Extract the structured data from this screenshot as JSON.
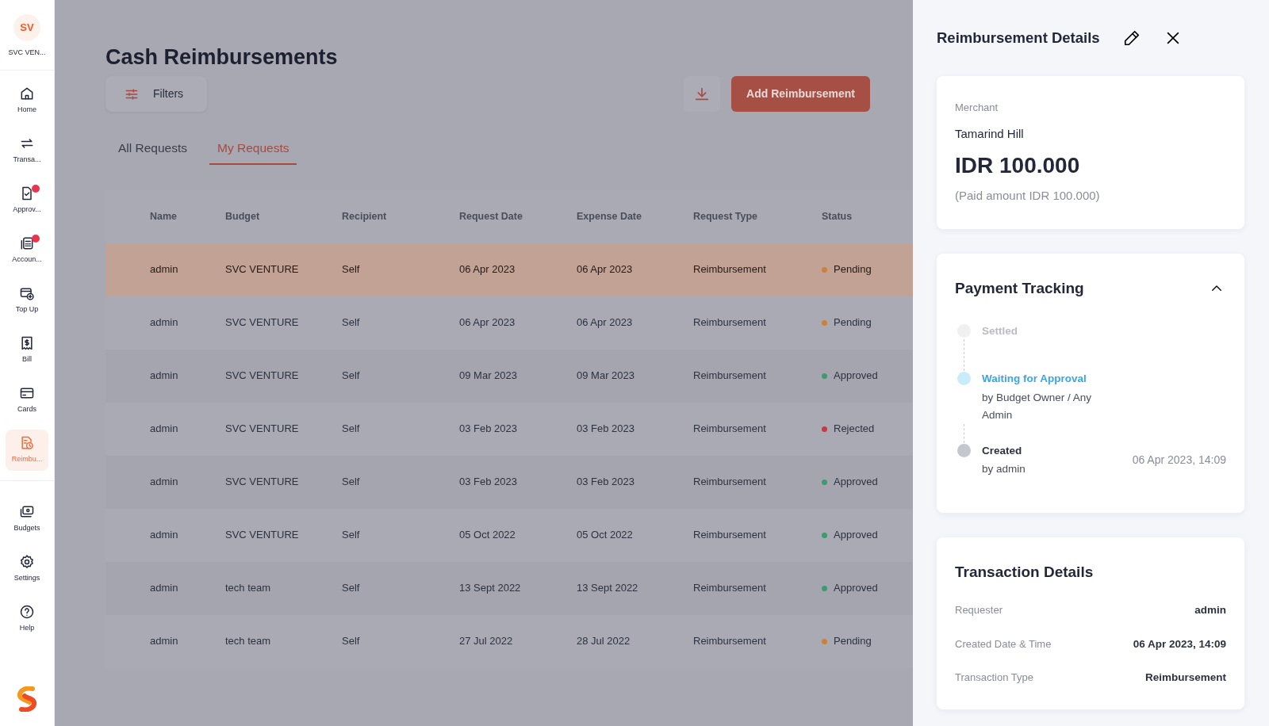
{
  "sidebar": {
    "org": {
      "initials": "SV",
      "name": "SVC VEN..."
    },
    "items": [
      {
        "label": "Home",
        "selected": false,
        "badge": false
      },
      {
        "label": "Transa...",
        "selected": false,
        "badge": false
      },
      {
        "label": "Approv...",
        "selected": false,
        "badge": true
      },
      {
        "label": "Accoun...",
        "selected": false,
        "badge": true
      },
      {
        "label": "Top Up",
        "selected": false,
        "badge": false
      },
      {
        "label": "Bill",
        "selected": false,
        "badge": false
      },
      {
        "label": "Cards",
        "selected": false,
        "badge": false
      },
      {
        "label": "Reimbu...",
        "selected": true,
        "badge": false
      }
    ],
    "bottom_items": [
      {
        "label": "Budgets",
        "selected": false,
        "badge": false
      },
      {
        "label": "Settings",
        "selected": false,
        "badge": false
      },
      {
        "label": "Help",
        "selected": false,
        "badge": false
      }
    ]
  },
  "page": {
    "title": "Cash Reimbursements",
    "filters_label": "Filters",
    "add_button": "Add Reimbursement"
  },
  "tabs": [
    {
      "label": "All Requests",
      "selected": false
    },
    {
      "label": "My Requests",
      "selected": true
    }
  ],
  "table": {
    "columns": [
      "Name",
      "Budget",
      "Recipient",
      "Request Date",
      "Expense Date",
      "Request Type",
      "Status"
    ],
    "rows": [
      {
        "cells": [
          "admin",
          "SVC VENTURE",
          "Self",
          "06 Apr 2023",
          "06 Apr 2023",
          "Reimbursement"
        ],
        "status": "Pending",
        "color": "#c9823c",
        "selected": true
      },
      {
        "cells": [
          "admin",
          "SVC VENTURE",
          "Self",
          "06 Apr 2023",
          "06 Apr 2023",
          "Reimbursement"
        ],
        "status": "Pending",
        "color": "#c9823c",
        "selected": false
      },
      {
        "cells": [
          "admin",
          "SVC VENTURE",
          "Self",
          "09 Mar 2023",
          "09 Mar 2023",
          "Reimbursement"
        ],
        "status": "Approved",
        "color": "#3f9a6e",
        "selected": false
      },
      {
        "cells": [
          "admin",
          "SVC VENTURE",
          "Self",
          "03 Feb 2023",
          "03 Feb 2023",
          "Reimbursement"
        ],
        "status": "Rejected",
        "color": "#c23b4c",
        "selected": false
      },
      {
        "cells": [
          "admin",
          "SVC VENTURE",
          "Self",
          "03 Feb 2023",
          "03 Feb 2023",
          "Reimbursement"
        ],
        "status": "Approved",
        "color": "#3f9a6e",
        "selected": false
      },
      {
        "cells": [
          "admin",
          "SVC VENTURE",
          "Self",
          "05 Oct 2022",
          "05 Oct 2022",
          "Reimbursement"
        ],
        "status": "Approved",
        "color": "#3f9a6e",
        "selected": false
      },
      {
        "cells": [
          "admin",
          "tech team",
          "Self",
          "13 Sept 2022",
          "13 Sept 2022",
          "Reimbursement"
        ],
        "status": "Approved",
        "color": "#3f9a6e",
        "selected": false
      },
      {
        "cells": [
          "admin",
          "tech team",
          "Self",
          "27 Jul 2022",
          "28 Jul 2022",
          "Reimbursement"
        ],
        "status": "Pending",
        "color": "#c9823c",
        "selected": false
      }
    ]
  },
  "panel": {
    "title": "Reimbursement Details",
    "merchant": {
      "label": "Merchant",
      "name": "Tamarind Hill",
      "amount": "IDR 100.000",
      "paid": "(Paid amount IDR 100.000)"
    },
    "tracking": {
      "title": "Payment Tracking",
      "expanded": true,
      "steps": [
        {
          "kind": "pending",
          "title": "Settled"
        },
        {
          "kind": "current",
          "title": "Waiting for Approval",
          "sub": "by Budget Owner / Any Admin"
        },
        {
          "kind": "done",
          "title": "Created",
          "sub": "by admin",
          "time": "06 Apr 2023, 14:09"
        }
      ]
    },
    "transaction": {
      "title": "Transaction Details",
      "rows": [
        {
          "label": "Requester",
          "value": "admin"
        },
        {
          "label": "Created Date & Time",
          "value": "06 Apr 2023, 14:09"
        },
        {
          "label": "Transaction Type",
          "value": "Reimbursement"
        }
      ]
    }
  }
}
